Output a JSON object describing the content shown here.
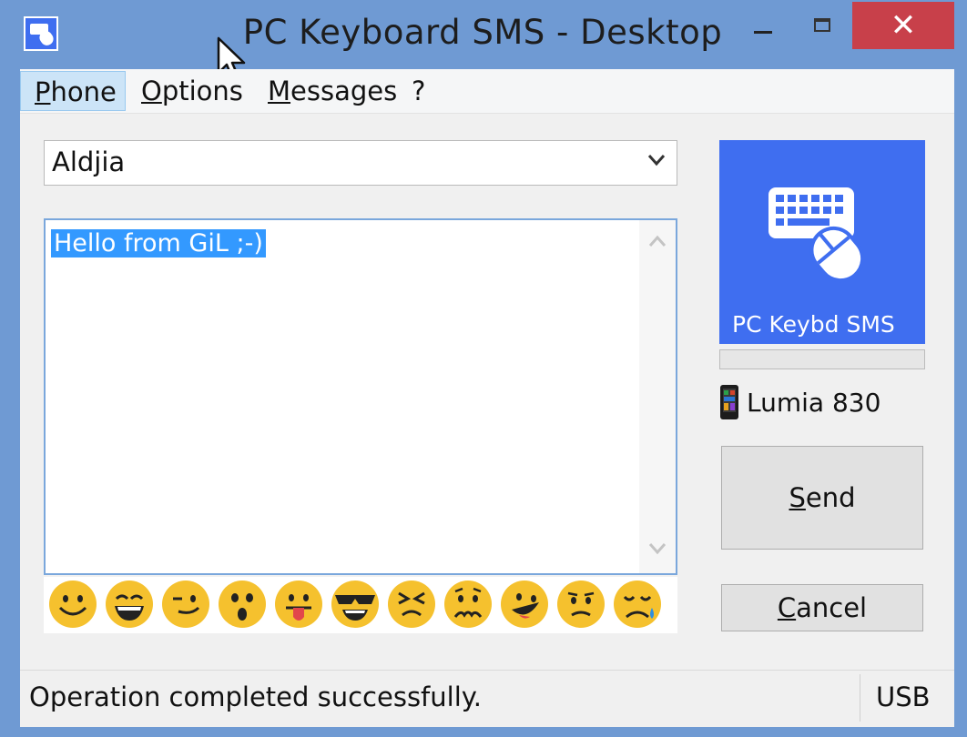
{
  "window": {
    "title": "PC Keyboard SMS - Desktop",
    "controls": {
      "close_glyph": "✕"
    }
  },
  "menu": {
    "items": [
      {
        "label_first": "P",
        "label_rest": "hone"
      },
      {
        "label_first": "O",
        "label_rest": "ptions"
      },
      {
        "label_first": "M",
        "label_rest": "essages"
      },
      {
        "label_first": "",
        "label_rest": "?"
      }
    ]
  },
  "recipient": {
    "value": "Aldjia"
  },
  "message": {
    "text": "Hello from GiL ;-)"
  },
  "emojis": [
    "smile-emoji",
    "grin-emoji",
    "wink-smile-emoji",
    "surprised-emoji",
    "tongue-out-emoji",
    "sunglasses-emoji",
    "squint-emoji",
    "worried-emoji",
    "silly-emoji",
    "frown-emoji",
    "crying-emoji"
  ],
  "logo": {
    "label": "PC Keybd SMS"
  },
  "progress": {
    "value": 0
  },
  "device": {
    "name": "Lumia 830"
  },
  "buttons": {
    "send_first": "S",
    "send_rest": "end",
    "cancel_first": "C",
    "cancel_rest": "ancel"
  },
  "status": {
    "text": "Operation completed successfully.",
    "connection": "USB"
  },
  "colors": {
    "accent": "#3f6ef0",
    "selection": "#3399ff",
    "close": "#c8404a",
    "emoji": "#f5c12e"
  }
}
